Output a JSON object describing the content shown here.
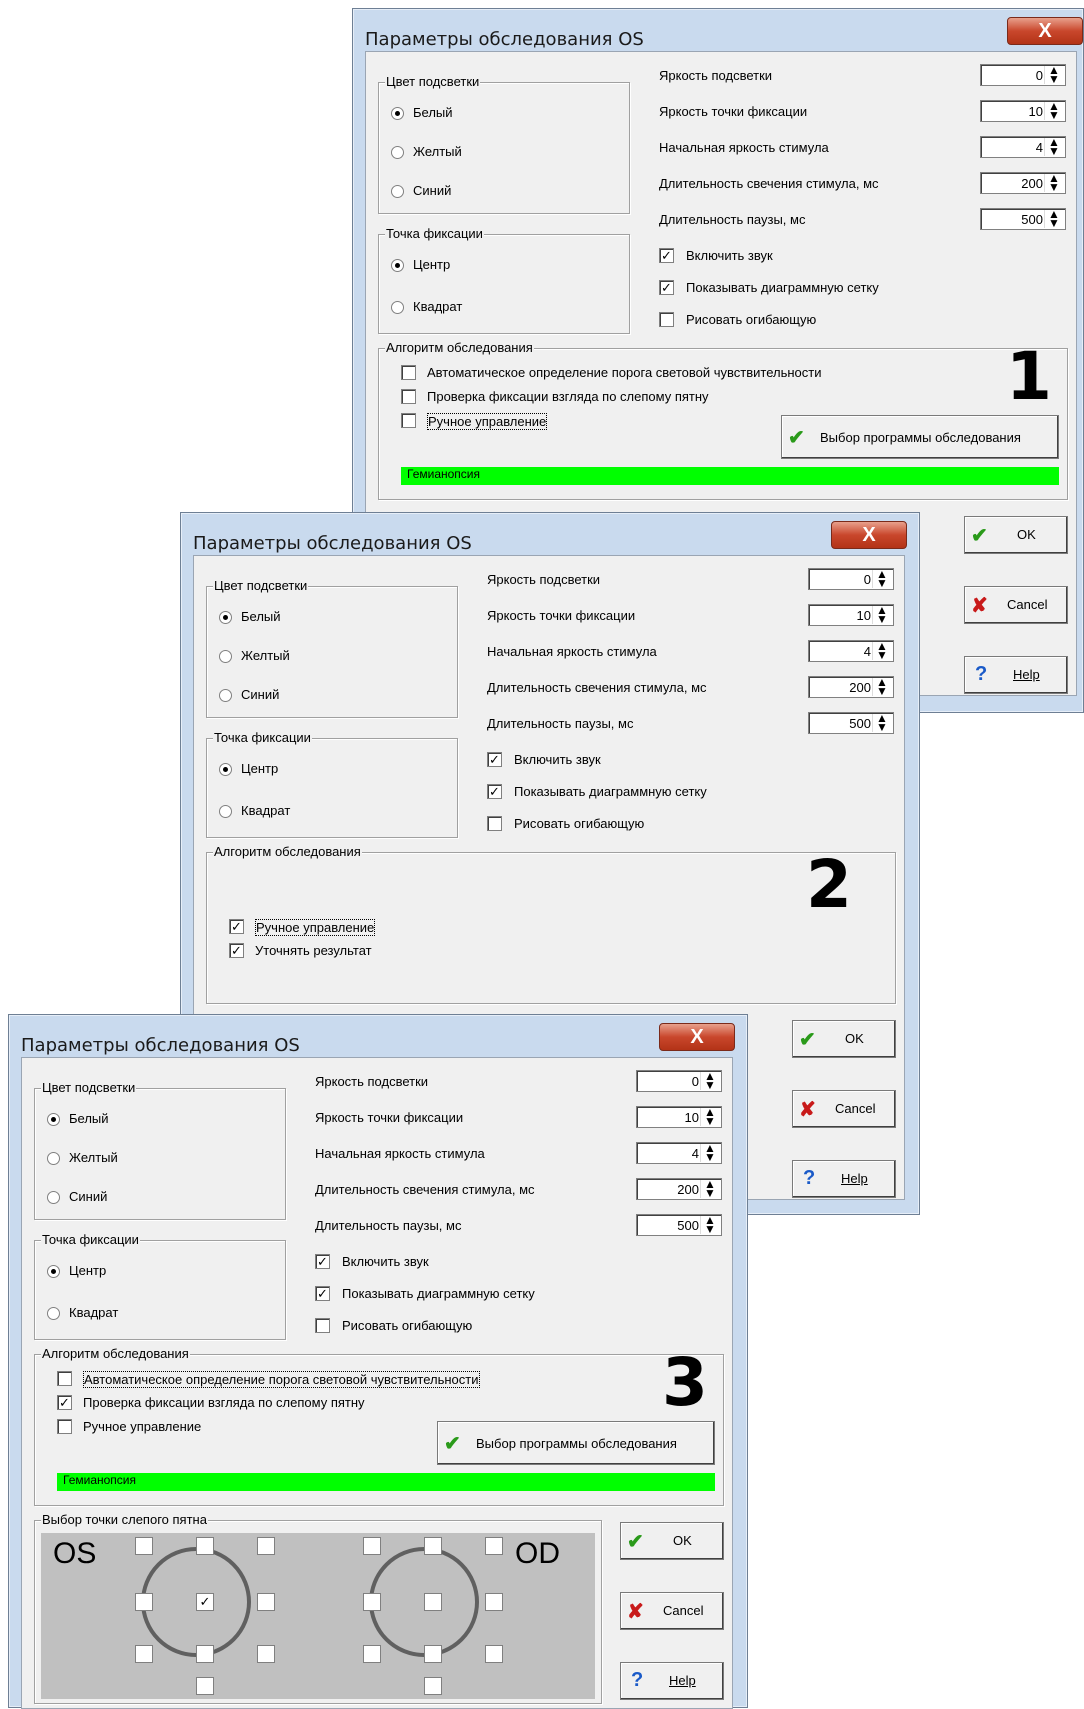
{
  "dialog": {
    "title": "Параметры обследования OS",
    "close_glyph": "X",
    "color_group": "Цвет подсветки",
    "color_options": [
      "Белый",
      "Желтый",
      "Синий"
    ],
    "fixation_group": "Точка фиксации",
    "fixation_options": [
      "Центр",
      "Квадрат"
    ],
    "params": [
      {
        "label": "Яркость подсветки",
        "value": "0"
      },
      {
        "label": "Яркость точки фиксации",
        "value": "10"
      },
      {
        "label": "Начальная яркость стимула",
        "value": "4"
      },
      {
        "label": "Длительность свечения стимула, мс",
        "value": "200"
      },
      {
        "label": "Длительность паузы, мс",
        "value": "500"
      }
    ],
    "checks": [
      "Включить звук",
      "Показывать диаграммную сетку",
      "Рисовать огибающую"
    ],
    "algo_group": "Алгоритм обследования",
    "algo_auto": "Автоматическое определение порога световой чувствительности",
    "algo_check": "Проверка фиксации взгляда по слепому пятну",
    "algo_manual": "Ручное управление",
    "algo_refine": "Уточнять результат",
    "program_button": "Выбор программы обследования",
    "program_value": "Гемианопсия",
    "ok": "OK",
    "cancel": "Cancel",
    "help": "Help",
    "blind_spot_group": "Выбор точки слепого пятна",
    "os": "OS",
    "od": "OD"
  },
  "markers": {
    "one": "1",
    "two": "2",
    "three": "3"
  },
  "colors": {
    "title_bar": "#c9daee",
    "close": "#c9472c",
    "green": "#00ff00"
  }
}
